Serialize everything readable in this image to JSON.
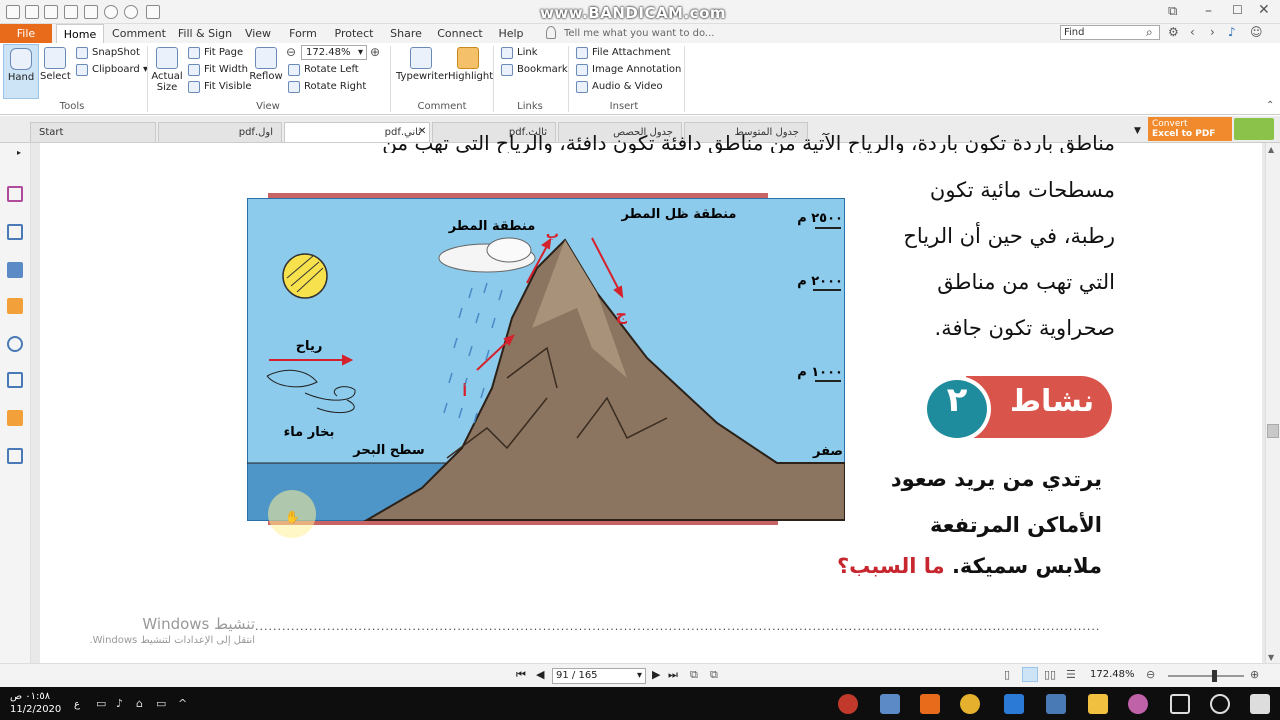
{
  "watermark": "www.BANDICAM.com",
  "menu": {
    "file": "File",
    "items": [
      "Home",
      "Comment",
      "Fill & Sign",
      "View",
      "Form",
      "Protect",
      "Share",
      "Connect",
      "Help"
    ],
    "tell_me": "Tell me what you want to do...",
    "find_placeholder": "Find"
  },
  "ribbon": {
    "hand": "Hand",
    "select": "Select",
    "snapshot": "SnapShot",
    "clipboard": "Clipboard",
    "tools_group": "Tools",
    "actual_size_1": "Actual",
    "actual_size_2": "Size",
    "fit_page": "Fit Page",
    "fit_width": "Fit Width",
    "fit_visible": "Fit Visible",
    "reflow": "Reflow",
    "zoom": "172.48%",
    "rotate_left": "Rotate Left",
    "rotate_right": "Rotate Right",
    "view_group": "View",
    "typewriter": "Typewriter",
    "highlight": "Highlight",
    "comment_group": "Comment",
    "link": "Link",
    "bookmark": "Bookmark",
    "links_group": "Links",
    "file_attachment": "File Attachment",
    "image_annotation": "Image Annotation",
    "audio_video": "Audio & Video",
    "insert_group": "Insert",
    "convert_1": "Convert",
    "convert_2": "Excel to PDF"
  },
  "tabs": [
    "Start",
    "اول.pdf",
    "ثاني.pdf",
    "ثالث.pdf",
    "جدول الحصص معلمين.pdf",
    "جدول المتوسط فصول.pdf"
  ],
  "document": {
    "partial_line": "مناطق باردة تكون باردة، والرياح الآتية من مناطق دافئة تكون دافئة، والرياح التي تهب من",
    "para_lines": [
      "مسطحات مائية تكون",
      "رطبة، في حين أن الرياح",
      "التي تهب من مناطق",
      "صحراوية تكون جافة."
    ],
    "activity_label": "نشاط",
    "activity_number": "٢",
    "activity_line1": "يرتدي من يريد صعود",
    "activity_line2": "الأماكن المرتفعة",
    "activity_line3": "ملابس سميكة.",
    "activity_question": "ما السبب؟",
    "dots": "................................................................................................................................................................................................................................................."
  },
  "figure": {
    "rain_shadow": "منطقة ظل المطر",
    "rain_zone": "منطقة المطر",
    "wind": "رياح",
    "vapor": "بخار ماء",
    "sea_level": "سطح البحر",
    "letter_a": "أ",
    "letter_b": "ب",
    "letter_c": "ج",
    "alt_2500": "٢٥٠٠ م",
    "alt_2000": "٢٠٠٠ م",
    "alt_1000": "١٠٠٠ م",
    "alt_0": "صفر"
  },
  "windows_activation": {
    "title": "تنشيط Windows",
    "subtitle": "انتقل إلى الإعدادات لتنشيط Windows."
  },
  "status": {
    "page": "91 / 165",
    "zoom": "172.48%"
  },
  "taskbar": {
    "time": "٠١:٥٨ ص",
    "date": "11/2/2020",
    "lang": "ع"
  }
}
